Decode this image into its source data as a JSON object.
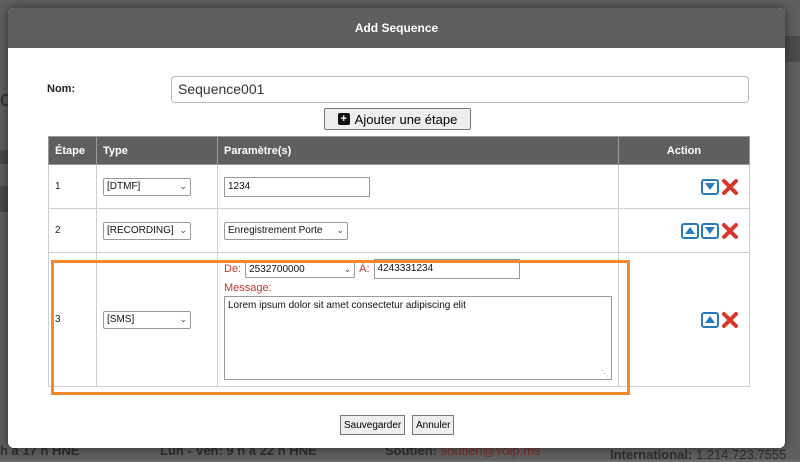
{
  "dialog": {
    "title": "Add Sequence"
  },
  "form": {
    "name_label": "Nom:",
    "name_value": "Sequence001"
  },
  "add_step_label": "Ajouter une étape",
  "table": {
    "headers": {
      "step": "Étape",
      "type": "Type",
      "params": "Paramètre(s)",
      "action": "Action"
    },
    "rows": [
      {
        "step": "1",
        "type": "[DTMF]",
        "param_value": "1234"
      },
      {
        "step": "2",
        "type": "[RECORDING]",
        "param_value": "Enregistrement Porte"
      },
      {
        "step": "3",
        "type": "[SMS]",
        "from_label": "De:",
        "from_value": "2532700000",
        "to_label": "À:",
        "to_value": "4243331234",
        "message_label": "Message:",
        "message_value": "Lorem ipsum dolor sit amet consectetur adipiscing elit"
      }
    ]
  },
  "footer": {
    "save_label": "Sauvegarder",
    "cancel_label": "Annuler"
  },
  "background": {
    "left_hours": "h à 17 h HNE",
    "mid_hours": "Lun - Ven: 9 h à 22 h HNE",
    "support_label": "Soutien:",
    "support_email": "soutien@voip.ms",
    "intl_label": "International:",
    "intl_phone": "1.214.723.7555"
  },
  "colors": {
    "highlight": "#f28a2a",
    "header_bg": "#5f5f5f",
    "arrow_blue": "#2a7ab8",
    "delete_red": "#d9362b"
  },
  "icons": {
    "add": "plus-square-icon",
    "up": "arrow-up-icon",
    "down": "arrow-down-icon",
    "delete": "delete-x-icon"
  }
}
